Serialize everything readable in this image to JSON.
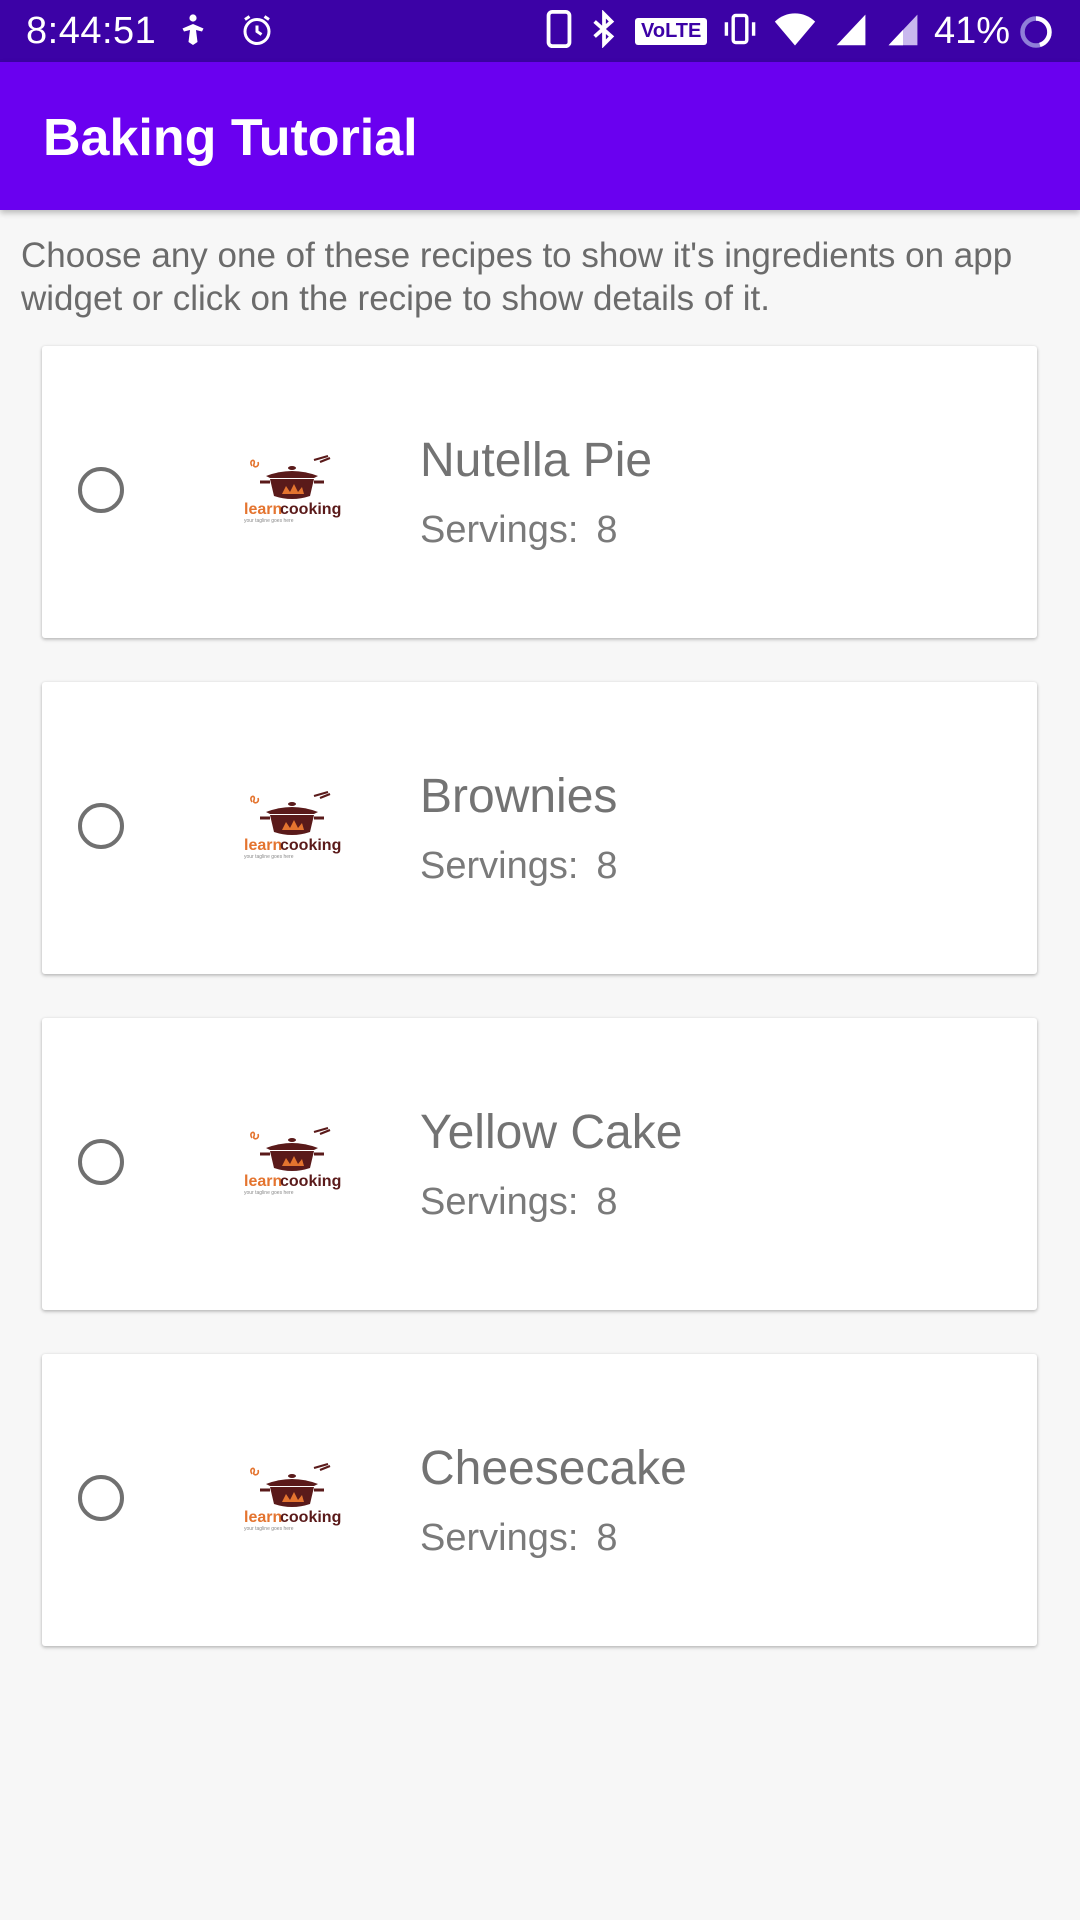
{
  "status_bar": {
    "time": "8:44:51",
    "battery_percent": "41%",
    "left_icons": [
      "accessibility-icon",
      "alarm-icon"
    ],
    "right_icons": [
      "phone-icon",
      "bluetooth-icon",
      "volte-icon",
      "vibrate-icon",
      "wifi-icon",
      "signal-icon",
      "signal-icon-2"
    ],
    "volte_label": "VoLTE",
    "colors": {
      "background": "#3c02a6"
    }
  },
  "app_bar": {
    "title": "Baking Tutorial",
    "color": "#6a00f0"
  },
  "instruction": "Choose any one of these recipes to show it's ingredients on app widget or click on the recipe to show details of it.",
  "recipes": [
    {
      "name": "Nutella Pie",
      "servings_label": "Servings:",
      "servings": "8",
      "selected": false,
      "logo_text_1": "learn",
      "logo_text_2": "cooking",
      "logo_tagline": "your tagline goes here"
    },
    {
      "name": "Brownies",
      "servings_label": "Servings:",
      "servings": "8",
      "selected": false,
      "logo_text_1": "learn",
      "logo_text_2": "cooking",
      "logo_tagline": "your tagline goes here"
    },
    {
      "name": "Yellow Cake",
      "servings_label": "Servings:",
      "servings": "8",
      "selected": false,
      "logo_text_1": "learn",
      "logo_text_2": "cooking",
      "logo_tagline": "your tagline goes here"
    },
    {
      "name": "Cheesecake",
      "servings_label": "Servings:",
      "servings": "8",
      "selected": false,
      "logo_text_1": "learn",
      "logo_text_2": "cooking",
      "logo_tagline": "your tagline goes here"
    }
  ]
}
